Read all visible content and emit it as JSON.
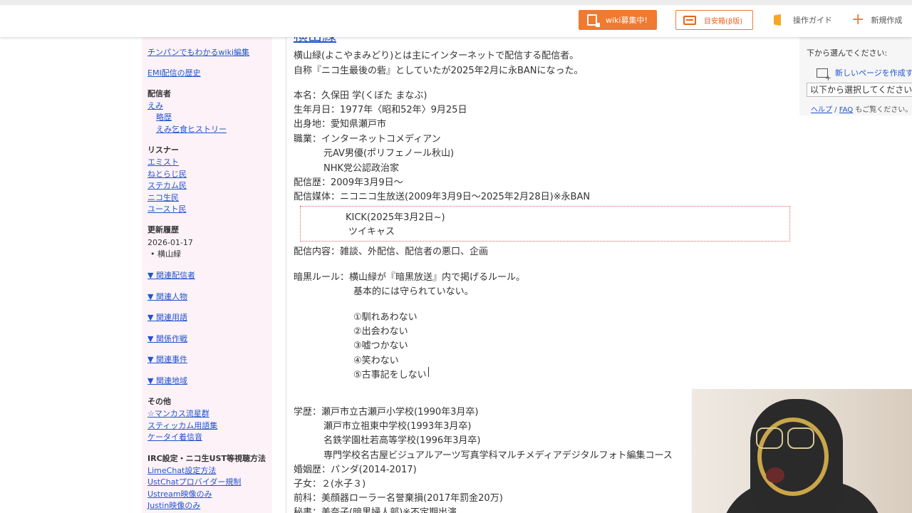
{
  "topbar": {
    "recruit_label": "wiki募集中!",
    "box_label": "目安箱(β版)",
    "guide_label": "操作ガイド",
    "new_label": "新規作成"
  },
  "sidebar": {
    "link1": "チンパンでもわかるwiki編集",
    "link2": "EMI配信の歴史",
    "streamer_head": "配信者",
    "emi": "えみ",
    "emi_sub1": "略歴",
    "emi_sub2": "えみ乞食ヒストリー",
    "listener_head": "リスナー",
    "listeners": [
      "エミスト",
      "ねとらじ民",
      "ステカム民",
      "ニコ生民",
      "ユースト民"
    ],
    "update_head": "更新履歴",
    "update_date": "2026-01-17",
    "update_item": "横山緑",
    "related": [
      "▼ 関連配信者",
      "▼ 関連人物",
      "▼ 関連用語",
      "▼ 関係作戦",
      "▼ 関連事件",
      "▼ 関連地域"
    ],
    "other_head": "その他",
    "others": [
      "☆マンカス流星群",
      "スティッカム用語集",
      "ケータイ着信音"
    ],
    "irc_head": "IRC設定・ニコ生UST等視聴方法",
    "irc": [
      "LimeChat設定方法",
      "UstChatプロバイダー規制",
      "Ustream映像のみ",
      "Justin映像のみ"
    ]
  },
  "main": {
    "title": "横山緑",
    "intro1": "横山緑(よこやまみどり)とは主にインターネットで配信する配信者。",
    "intro2": "自称『ニコ生最後の砦』としていたが2025年2月に永BANになった。",
    "name": "本名：久保田 学(くぼた まなぶ)",
    "birth": "生年月日：1977年〈昭和52年〉9月25日",
    "birthplace": "出身地：愛知県瀬戸市",
    "job": "職業：インターネットコメディアン",
    "job2": "元AV男優(ポリフェノール秋山)",
    "job3": "NHK党公認政治家",
    "history": "配信歴：2009年3月9日〜",
    "media": "配信媒体：ニコニコ生放送(2009年3月9日〜2025年2月28日)※永BAN",
    "kick": "KICK(2025年3月2日~)",
    "twitcas": "ツイキャス",
    "content": "配信内容：雑談、外配信、配信者の悪口、企画",
    "rule": "暗黒ルール：横山緑が『暗黒放送』内で掲げるルール。",
    "rule2": "基本的には守られていない。",
    "rules": [
      "①馴れあわない",
      "②出会わない",
      "③嘘つかない",
      "④笑わない",
      "⑤古事記をしない"
    ],
    "edu1": "学歴：瀬戸市立古瀬戸小学校(1990年3月卒)",
    "edu2": "瀬戸市立祖東中学校(1993年3月卒)",
    "edu3": "名鉄学園杜若高等学校(1996年3月卒)",
    "edu4": "専門学校名古屋ビジュアルアーツ写真学科マルチメディアデジタルフォト編集コース",
    "marriage": "婚姻歴：パンダ(2014-2017)",
    "children": "子女：２(水子３)",
    "record": "前科：美顔器ローラー名誉棄損(2017年罰金20万)",
    "secretary": "秘書：美奈子(暗黒婦人部)※不定期出演"
  },
  "rpanel": {
    "title": "下から選んでください:",
    "newpage": "新しいページを作成する",
    "select": "以下から選択してください",
    "help_link1": "ヘルプ",
    "help_sep": " / ",
    "help_link2": "FAQ",
    "help_tail": " もご覧ください。"
  }
}
